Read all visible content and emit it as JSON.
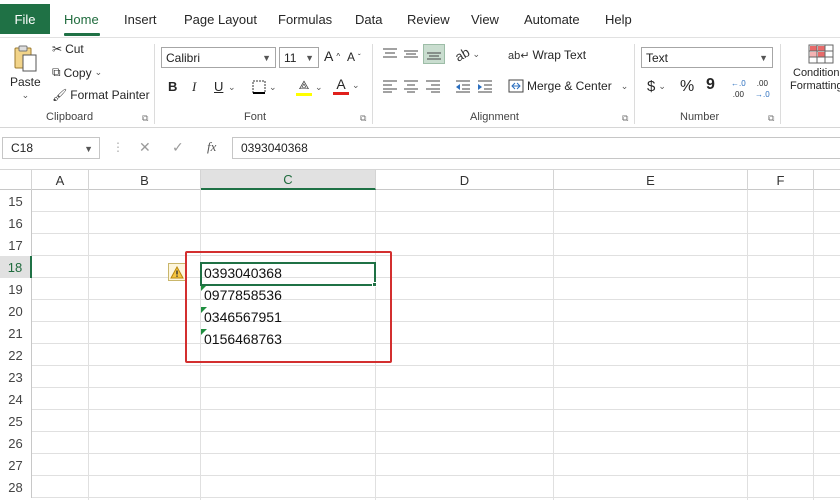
{
  "menu": {
    "tabs": [
      "File",
      "Home",
      "Insert",
      "Page Layout",
      "Formulas",
      "Data",
      "Review",
      "View",
      "Automate",
      "Help"
    ]
  },
  "ribbon": {
    "clipboard": {
      "paste": "Paste",
      "cut": "Cut",
      "copy": "Copy",
      "format_painter": "Format Painter",
      "label": "Clipboard"
    },
    "font": {
      "name": "Calibri",
      "size": "11",
      "bold": "B",
      "italic": "I",
      "underline": "U",
      "color_letter": "A",
      "grow": "A",
      "shrink": "A",
      "label": "Font",
      "font_color": "#e0201b",
      "fill_color": "#ffff00"
    },
    "alignment": {
      "wrap": "Wrap Text",
      "merge": "Merge & Center",
      "label": "Alignment"
    },
    "number": {
      "format": "Text",
      "currency": "$",
      "percent": "%",
      "comma": "9",
      "label": "Number"
    },
    "styles": {
      "conditional_line1": "Conditional",
      "conditional_line2": "Formatting"
    }
  },
  "formula_bar": {
    "name_box": "C18",
    "fx": "fx",
    "value": "0393040368"
  },
  "grid": {
    "columns": [
      "A",
      "B",
      "C",
      "D",
      "E",
      "F"
    ],
    "rows": [
      "15",
      "16",
      "17",
      "18",
      "19",
      "20",
      "21",
      "22",
      "23",
      "24",
      "25",
      "26",
      "27",
      "28"
    ],
    "active_column": "C",
    "active_row": "18",
    "cells": {
      "C18": "0393040368",
      "C19": "0977858536",
      "C20": "0346567951",
      "C21": "0156468763"
    }
  },
  "colors": {
    "accent": "#1f7145",
    "highlight_box": "#d32f2f",
    "error_triangle": "#1e8e3e"
  }
}
